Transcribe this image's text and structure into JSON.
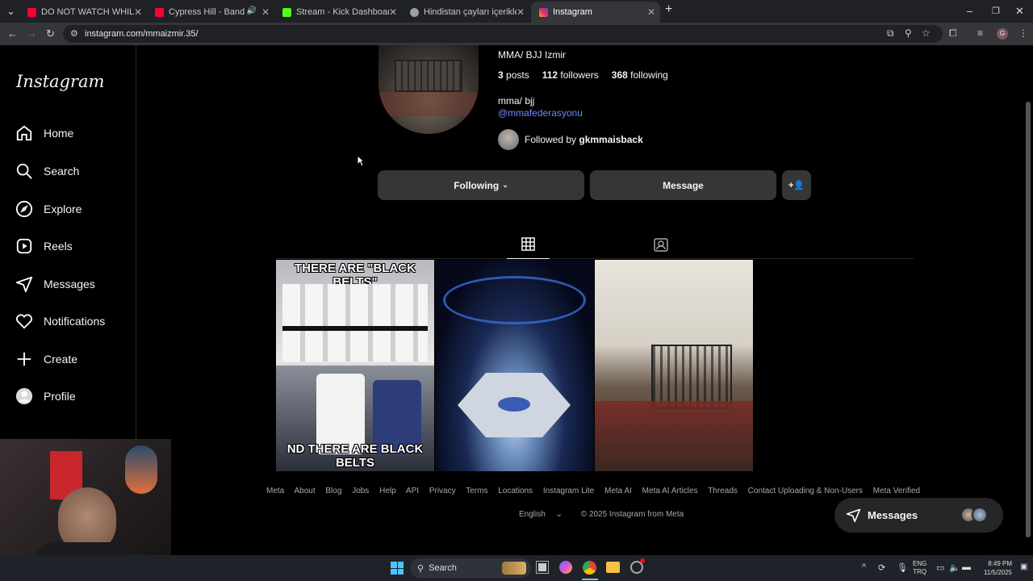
{
  "browser": {
    "tabs": [
      {
        "label": "DO NOT WATCH WHILE EATING",
        "color": "#ff0033"
      },
      {
        "label": "Cypress Hill - Band of Gyps",
        "color": "#ff0033"
      },
      {
        "label": "Stream - Kick Dashboard",
        "color": "#53fc18"
      },
      {
        "label": "Hindistan çayları içerikleri",
        "color": "#9aa0a6"
      },
      {
        "label": "Instagram",
        "color": "#e1306c"
      }
    ],
    "url": "instagram.com/mmaizmir.35/"
  },
  "sidebar": {
    "logo": "Instagram",
    "items": [
      {
        "label": "Home",
        "icon": "home-icon"
      },
      {
        "label": "Search",
        "icon": "search-icon"
      },
      {
        "label": "Explore",
        "icon": "compass-icon"
      },
      {
        "label": "Reels",
        "icon": "reels-icon"
      },
      {
        "label": "Messages",
        "icon": "send-icon"
      },
      {
        "label": "Notifications",
        "icon": "heart-icon"
      },
      {
        "label": "Create",
        "icon": "plus-icon"
      },
      {
        "label": "Profile",
        "icon": "profile-icon"
      }
    ]
  },
  "profile": {
    "name": "MMA/ BJJ Izmir",
    "posts_count": "3",
    "posts_label": "posts",
    "followers_count": "112",
    "followers_label": "followers",
    "following_count": "368",
    "following_label": "following",
    "bio": "mma/ bjj",
    "mention": "@mmafederasyonu",
    "followed_by_prefix": "Followed by",
    "followed_by_user": "gkmmaisback"
  },
  "actions": {
    "following_label": "Following",
    "message_label": "Message"
  },
  "posts": [
    {
      "caption_top": "THERE ARE \"BLACK BELTS\"",
      "caption_bottom": "ND THERE ARE BLACK BELTS"
    },
    {
      "caption_top": "",
      "caption_bottom": ""
    },
    {
      "caption_top": "",
      "caption_bottom": ""
    }
  ],
  "footer": {
    "links": [
      "Meta",
      "About",
      "Blog",
      "Jobs",
      "Help",
      "API",
      "Privacy",
      "Terms",
      "Locations",
      "Instagram Lite",
      "Meta AI",
      "Meta AI Articles",
      "Threads",
      "Contact Uploading & Non-Users",
      "Meta Verified"
    ],
    "language": "English",
    "copyright": "© 2025 Instagram from Meta"
  },
  "messages_pill": {
    "label": "Messages"
  },
  "taskbar": {
    "search_label": "Search",
    "lang_top": "ENG",
    "lang_bottom": "TRQ",
    "time": "8:49 PM",
    "date": "11/5/2025"
  },
  "colors": {
    "accent_link": "#e0f1ff",
    "mention": "#6b8cff",
    "button_bg": "#363636"
  }
}
